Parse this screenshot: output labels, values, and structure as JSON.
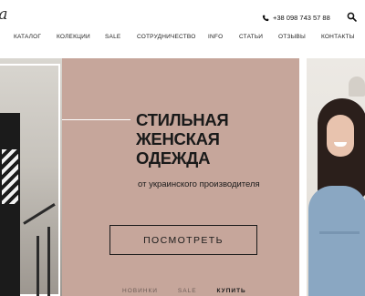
{
  "header": {
    "logo_text": "la",
    "phone": "+38 098 743 57 88",
    "icons": {
      "phone": "phone-icon",
      "search": "search-icon"
    }
  },
  "nav": {
    "items": [
      {
        "label": "КАТАЛОГ"
      },
      {
        "label": "КОЛЕКЦИИ"
      },
      {
        "label": "SALE"
      },
      {
        "label": "СОТРУДНИЧЕСТВО"
      },
      {
        "label": "INFO"
      },
      {
        "label": "СТАТЬИ"
      },
      {
        "label": "ОТЗЫВЫ"
      },
      {
        "label": "КОНТАКТЫ"
      }
    ]
  },
  "hero": {
    "title_lines": [
      "СТИЛЬНАЯ",
      "ЖЕНСКАЯ",
      "ОДЕЖДА"
    ],
    "subtitle": "от украинского производителя",
    "button_label": "ПОСМОТРЕТЬ",
    "tabs": [
      {
        "label": "НОВИНКИ",
        "active": false
      },
      {
        "label": "SALE",
        "active": false
      },
      {
        "label": "КУПИТЬ",
        "active": true
      }
    ]
  },
  "colors": {
    "hero_background": "#c6a69b",
    "text": "#1a1a1a",
    "page_background": "#ffffff"
  }
}
